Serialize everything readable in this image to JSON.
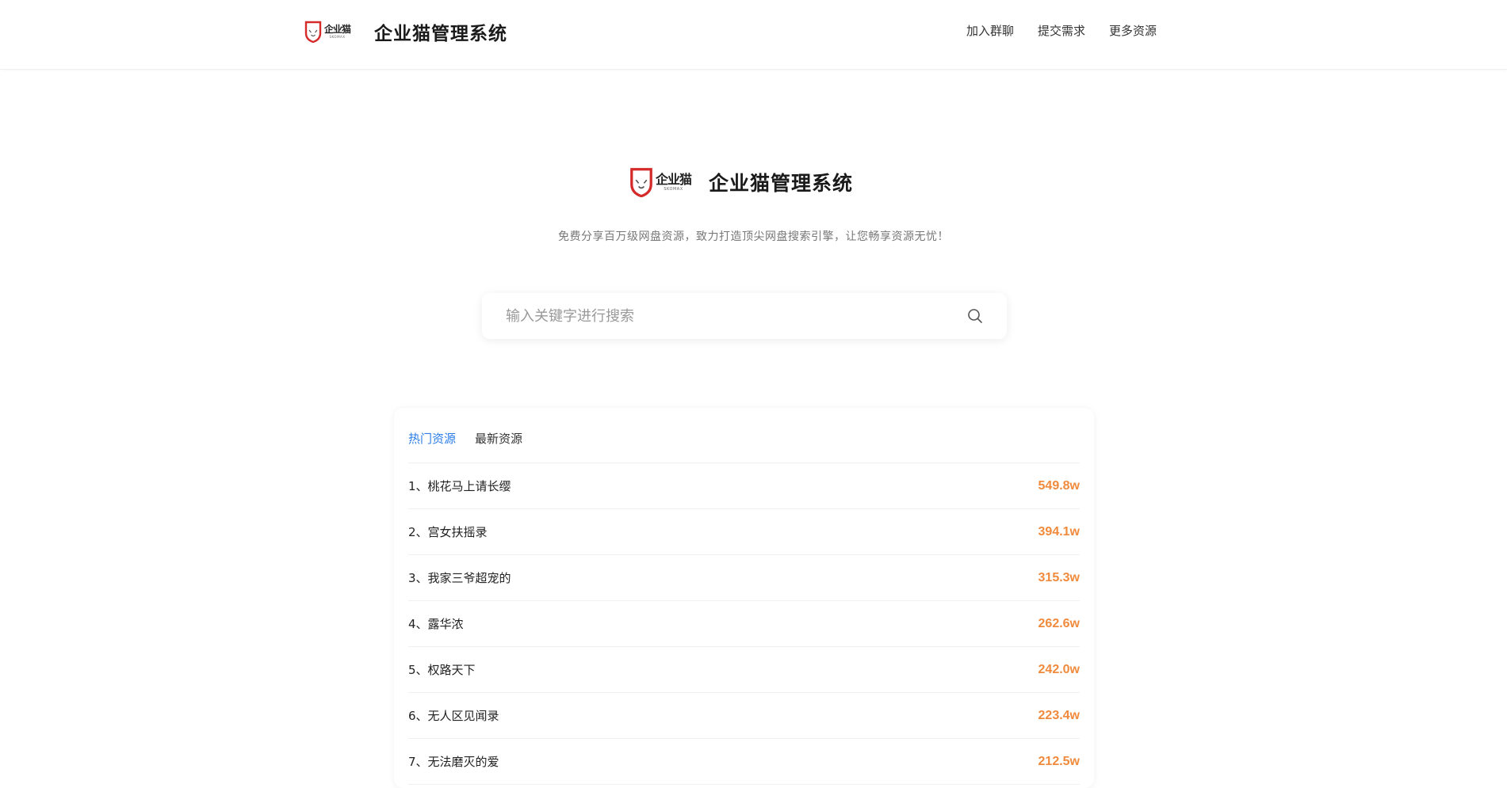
{
  "header": {
    "logo_text": "企业猫",
    "logo_subtext": "SKOMAX",
    "title": "企业猫管理系统",
    "nav": [
      {
        "label": "加入群聊"
      },
      {
        "label": "提交需求"
      },
      {
        "label": "更多资源"
      }
    ]
  },
  "hero": {
    "logo_text": "企业猫",
    "logo_subtext": "SKOMAX",
    "title": "企业猫管理系统",
    "subtitle": "免费分享百万级网盘资源，致力打造顶尖网盘搜索引擎，让您畅享资源无忧！"
  },
  "search": {
    "placeholder": "输入关键字进行搜索",
    "value": ""
  },
  "resources": {
    "tabs": [
      {
        "label": "热门资源",
        "active": true
      },
      {
        "label": "最新资源",
        "active": false
      }
    ],
    "items": [
      {
        "name": "1、桃花马上请长缨",
        "count": "549.8w"
      },
      {
        "name": "2、宫女扶摇录",
        "count": "394.1w"
      },
      {
        "name": "3、我家三爷超宠的",
        "count": "315.3w"
      },
      {
        "name": "4、露华浓",
        "count": "262.6w"
      },
      {
        "name": "5、权路天下",
        "count": "242.0w"
      },
      {
        "name": "6、无人区见闻录",
        "count": "223.4w"
      },
      {
        "name": "7、无法磨灭的爱",
        "count": "212.5w"
      }
    ]
  },
  "colors": {
    "accent": "#2b7de9",
    "count": "#f08a3c",
    "logo_red": "#d42a2a"
  }
}
